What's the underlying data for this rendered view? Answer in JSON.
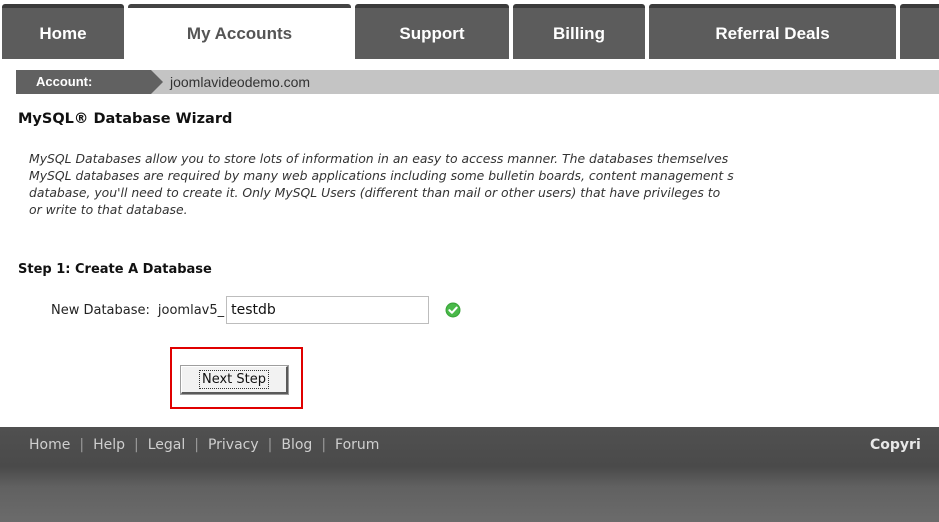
{
  "tabs": [
    {
      "label": "Home"
    },
    {
      "label": "My Accounts"
    },
    {
      "label": "Support"
    },
    {
      "label": "Billing"
    },
    {
      "label": "Referral Deals"
    }
  ],
  "account": {
    "label": "Account:",
    "name": "joomlavideodemo.com"
  },
  "wizard": {
    "title": "MySQL® Database Wizard",
    "intro_lines": [
      "MySQL Databases allow you to store lots of information in an easy to access manner. The databases themselves",
      "MySQL databases are required by many web applications including some bulletin boards, content management s",
      "database, you'll need to create it. Only MySQL Users (different than mail or other users) that have privileges to",
      "or write to that database."
    ],
    "step_title": "Step 1: Create A Database",
    "new_db_label": "New Database:",
    "db_prefix": "joomlav5_",
    "db_value": "testdb",
    "valid_icon": "check-circle-icon",
    "next_button": "Next Step",
    "highlight_color": "#e00000"
  },
  "footer": {
    "links": [
      "Home",
      "Help",
      "Legal",
      "Privacy",
      "Blog",
      "Forum"
    ],
    "copyright": "Copyri"
  },
  "colors": {
    "tab_bg": "#5c5c5c",
    "account_bar": "#c4c4c4",
    "footer_bg": "#505050",
    "valid_green": "#3aa53a"
  }
}
